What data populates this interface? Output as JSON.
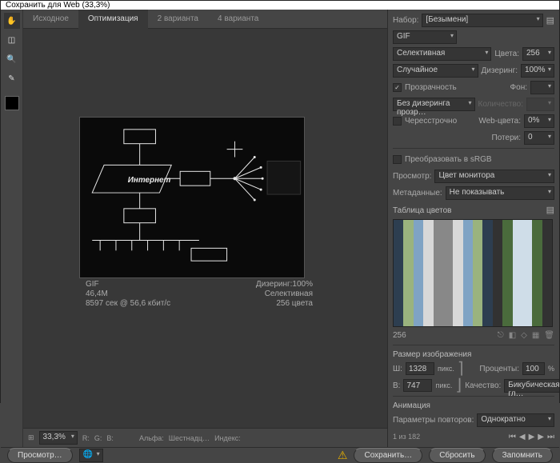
{
  "title": "Сохранить для Web (33,3%)",
  "tabs": {
    "src": "Исходное",
    "opt": "Оптимизация",
    "v2": "2 варианта",
    "v4": "4 варианта"
  },
  "preview_label": "Интернет",
  "status": {
    "format": "GIF",
    "size": "46,4M",
    "timing": "8597 сек @ 56,6 кбит/с",
    "dither": "Дизеринг:100%",
    "method": "Селективная",
    "colors": "256 цвета"
  },
  "zoom": "33,3%",
  "channels": {
    "r": "R:",
    "g": "G:",
    "b": "B:",
    "alpha": "Альфа:",
    "hex": "Шестнадц…",
    "index": "Индекс:"
  },
  "right": {
    "preset": "Набор:",
    "preset_val": "[Безымени]",
    "format": "GIF",
    "sel": "Селективная",
    "colors_lbl": "Цвета:",
    "colors": "256",
    "dither_method": "Случайное",
    "dither_lbl": "Дизеринг:",
    "dither": "100%",
    "transparency": "Прозрачность",
    "matte_lbl": "Фон:",
    "tdither": "Без дизеринга прозр…",
    "amount_lbl": "Количество:",
    "interlaced": "Чересстрочно",
    "websnap_lbl": "Web-цвета:",
    "websnap": "0%",
    "lossy_lbl": "Потери:",
    "lossy": "0",
    "srgb": "Преобразовать в sRGB",
    "preview_lbl": "Просмотр:",
    "preview_val": "Цвет монитора",
    "meta_lbl": "Метаданные:",
    "meta_val": "Не показывать",
    "palette_title": "Таблица цветов",
    "palette_count": "256",
    "size_title": "Размер изображения",
    "w_lbl": "Ш:",
    "w": "1328",
    "px": "пикс.",
    "h_lbl": "В:",
    "h": "747",
    "percent_lbl": "Проценты:",
    "percent": "100",
    "pct": "%",
    "quality_lbl": "Качество:",
    "quality": "Бикубическая, гл…",
    "anim_title": "Анимация",
    "loop_lbl": "Параметры повторов:",
    "loop": "Однократно",
    "frames": "1 из 182"
  },
  "footer": {
    "preview": "Просмотр…",
    "save": "Сохранить…",
    "cancel": "Сбросить",
    "remember": "Запомнить"
  }
}
